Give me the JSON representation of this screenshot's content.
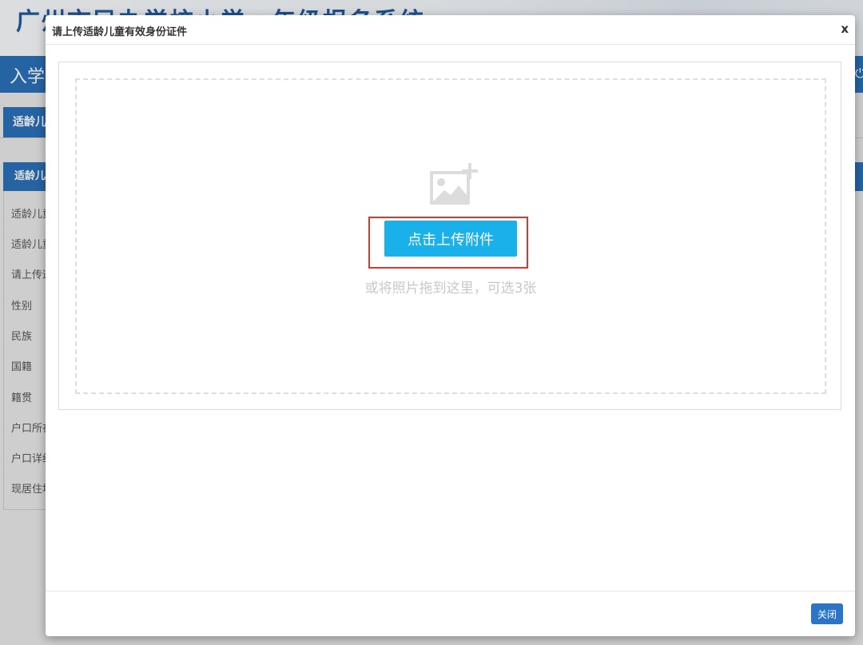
{
  "background": {
    "header_title": "广州市民办学校小学一年级报名系统",
    "nav_text": "入学",
    "tab_label": "适龄儿",
    "panel_title": "适龄儿",
    "panel_rows": [
      "适龄儿童",
      "适龄儿童",
      "请上传适",
      "性别",
      "民族",
      "国籍",
      "籍贯",
      "户口所在",
      "户口详细",
      "现居住地"
    ]
  },
  "modal": {
    "title": "请上传适龄儿童有效身份证件",
    "close_x": "x",
    "upload": {
      "icon": "image-add-icon",
      "button_label": "点击上传附件",
      "hint": "或将照片拖到这里，可选3张",
      "highlight_color": "#e0352b",
      "button_color": "#1ab0ea"
    },
    "footer": {
      "close_label": "关闭"
    }
  }
}
